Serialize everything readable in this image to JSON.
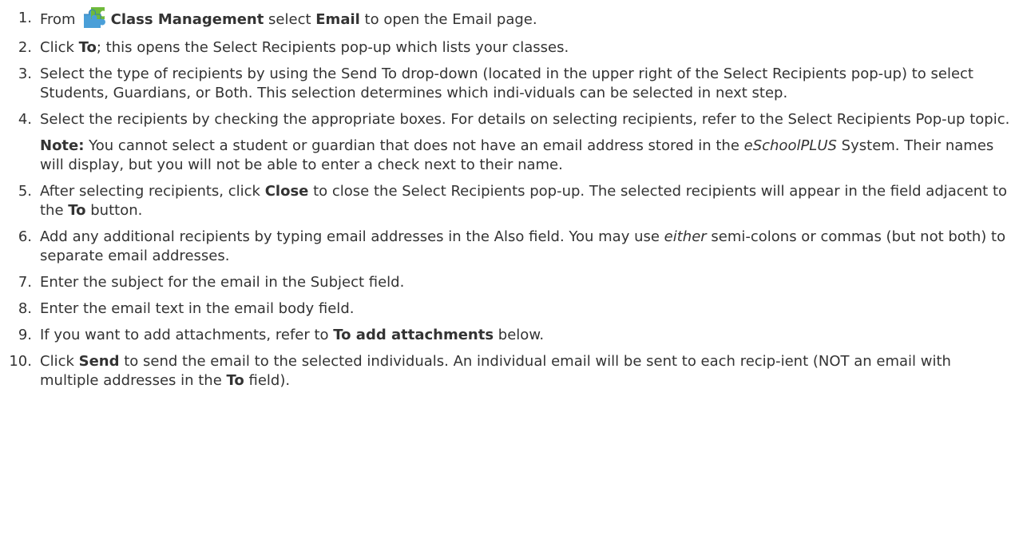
{
  "steps": [
    {
      "num": "1.",
      "pre": "From",
      "bold": "Class Management",
      "mid": " select ",
      "bold2": "Email",
      "mid2": " to open the ",
      "link": "Email",
      "post": " page."
    },
    {
      "num": "2.",
      "pre": "Click ",
      "bold": "To",
      "post": "; this opens the Select Recipients pop-up which lists your classes."
    },
    {
      "num": "3.",
      "text": "Select the type of recipients by using the Send To drop-down (located in the upper right of the Select Recipients pop-up) to select Students, Guardians, or Both. This selection determines which indi-viduals can be selected in next step."
    },
    {
      "num": "4.",
      "pre": "Select the recipients by checking the appropriate boxes. For details on selecting recipients, refer to the ",
      "link": "Select Recipients Pop-up",
      "post": " topic.",
      "note_label": "Note:",
      "note_pre": " You cannot select a student or guardian that does not have an email address stored in the ",
      "note_italic": "eSchoolPLUS",
      "note_post": " System. Their names will display, but you will not be able to enter a check next to their name."
    },
    {
      "num": "5.",
      "pre": "After selecting recipients, click ",
      "bold": "Close",
      "mid": " to close the Select Recipients pop-up. The selected recipients will appear in the field adjacent to the ",
      "bold2": "To",
      "post": " button."
    },
    {
      "num": "6.",
      "pre": "Add any additional recipients by typing email addresses in the Also field. You may use ",
      "italic": "either",
      "post": " semi-colons or commas (but not both) to separate email addresses."
    },
    {
      "num": "7.",
      "text": "Enter the subject for the email in the Subject field."
    },
    {
      "num": "8.",
      "text": "Enter the email text in the email body field."
    },
    {
      "num": "9.",
      "pre": "If you want to add attachments, refer to ",
      "bold": "To add attachments",
      "post": " below."
    },
    {
      "num": "10.",
      "pre": "Click ",
      "bold": "Send",
      "mid": " to send the email to the selected individuals. An individual email will be sent to each recip-ient (NOT an email with multiple addresses in the ",
      "bold2": "To",
      "post": " field)."
    }
  ],
  "icons": {
    "class_management": "puzzle-icon"
  },
  "colors": {
    "text": "#333333",
    "puzzle_blue": "#4a9fd8",
    "puzzle_green": "#6fba3a"
  }
}
